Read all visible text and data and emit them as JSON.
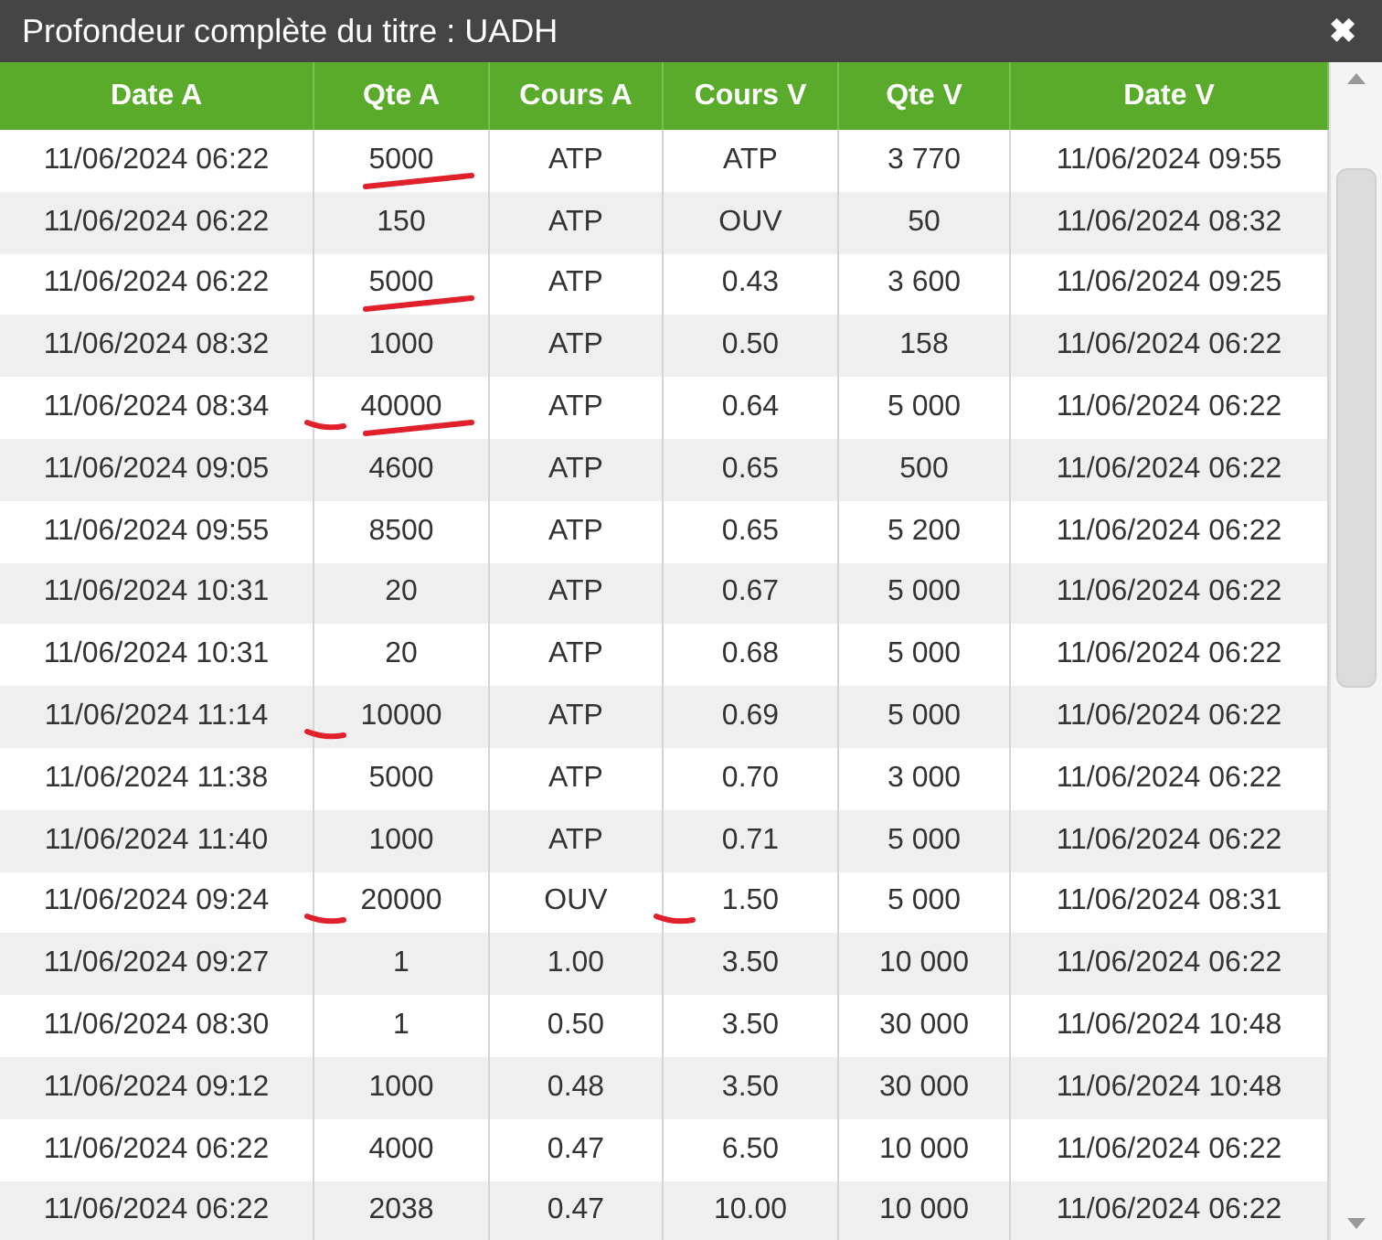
{
  "window": {
    "title": "Profondeur complète du titre : UADH",
    "close": "✖"
  },
  "table": {
    "columns": [
      "Date A",
      "Qte A",
      "Cours A",
      "Cours V",
      "Qte V",
      "Date V"
    ],
    "rows": [
      [
        {
          "text": "11/06/2024 06:22"
        },
        {
          "text": "5000",
          "pen_underline": true
        },
        {
          "text": "ATP"
        },
        {
          "text": "ATP"
        },
        {
          "text": "3 770"
        },
        {
          "text": "11/06/2024 09:55"
        }
      ],
      [
        {
          "text": "11/06/2024 06:22"
        },
        {
          "text": "150"
        },
        {
          "text": "ATP"
        },
        {
          "text": "OUV"
        },
        {
          "text": "50"
        },
        {
          "text": "11/06/2024 08:32"
        }
      ],
      [
        {
          "text": "11/06/2024 06:22"
        },
        {
          "text": "5000",
          "pen_underline": true
        },
        {
          "text": "ATP"
        },
        {
          "text": "0.43"
        },
        {
          "text": "3 600"
        },
        {
          "text": "11/06/2024 09:25"
        }
      ],
      [
        {
          "text": "11/06/2024 08:32"
        },
        {
          "text": "1000"
        },
        {
          "text": "ATP"
        },
        {
          "text": "0.50"
        },
        {
          "text": "158"
        },
        {
          "text": "11/06/2024 06:22"
        }
      ],
      [
        {
          "text": "11/06/2024 08:34"
        },
        {
          "text": "40000",
          "pen_dash": true,
          "pen_underline": true
        },
        {
          "text": "ATP"
        },
        {
          "text": "0.64"
        },
        {
          "text": "5 000"
        },
        {
          "text": "11/06/2024 06:22"
        }
      ],
      [
        {
          "text": "11/06/2024 09:05"
        },
        {
          "text": "4600"
        },
        {
          "text": "ATP"
        },
        {
          "text": "0.65"
        },
        {
          "text": "500"
        },
        {
          "text": "11/06/2024 06:22"
        }
      ],
      [
        {
          "text": "11/06/2024 09:55"
        },
        {
          "text": "8500"
        },
        {
          "text": "ATP"
        },
        {
          "text": "0.65"
        },
        {
          "text": "5 200"
        },
        {
          "text": "11/06/2024 06:22"
        }
      ],
      [
        {
          "text": "11/06/2024 10:31"
        },
        {
          "text": "20"
        },
        {
          "text": "ATP"
        },
        {
          "text": "0.67"
        },
        {
          "text": "5 000"
        },
        {
          "text": "11/06/2024 06:22"
        }
      ],
      [
        {
          "text": "11/06/2024 10:31"
        },
        {
          "text": "20"
        },
        {
          "text": "ATP"
        },
        {
          "text": "0.68"
        },
        {
          "text": "5 000"
        },
        {
          "text": "11/06/2024 06:22"
        }
      ],
      [
        {
          "text": "11/06/2024 11:14"
        },
        {
          "text": "10000",
          "pen_dash": true
        },
        {
          "text": "ATP"
        },
        {
          "text": "0.69"
        },
        {
          "text": "5 000"
        },
        {
          "text": "11/06/2024 06:22"
        }
      ],
      [
        {
          "text": "11/06/2024 11:38"
        },
        {
          "text": "5000"
        },
        {
          "text": "ATP"
        },
        {
          "text": "0.70"
        },
        {
          "text": "3 000"
        },
        {
          "text": "11/06/2024 06:22"
        }
      ],
      [
        {
          "text": "11/06/2024 11:40"
        },
        {
          "text": "1000"
        },
        {
          "text": "ATP"
        },
        {
          "text": "0.71"
        },
        {
          "text": "5 000"
        },
        {
          "text": "11/06/2024 06:22"
        }
      ],
      [
        {
          "text": "11/06/2024 09:24"
        },
        {
          "text": "20000",
          "pen_dash": true
        },
        {
          "text": "OUV"
        },
        {
          "text": "1.50",
          "pen_dash": true
        },
        {
          "text": "5 000"
        },
        {
          "text": "11/06/2024 08:31"
        }
      ],
      [
        {
          "text": "11/06/2024 09:27"
        },
        {
          "text": "1"
        },
        {
          "text": "1.00"
        },
        {
          "text": "3.50"
        },
        {
          "text": "10 000"
        },
        {
          "text": "11/06/2024 06:22"
        }
      ],
      [
        {
          "text": "11/06/2024 08:30"
        },
        {
          "text": "1"
        },
        {
          "text": "0.50"
        },
        {
          "text": "3.50"
        },
        {
          "text": "30 000"
        },
        {
          "text": "11/06/2024 10:48"
        }
      ],
      [
        {
          "text": "11/06/2024 09:12"
        },
        {
          "text": "1000"
        },
        {
          "text": "0.48"
        },
        {
          "text": "3.50"
        },
        {
          "text": "30 000"
        },
        {
          "text": "11/06/2024 10:48"
        }
      ],
      [
        {
          "text": "11/06/2024 06:22"
        },
        {
          "text": "4000"
        },
        {
          "text": "0.47"
        },
        {
          "text": "6.50"
        },
        {
          "text": "10 000"
        },
        {
          "text": "11/06/2024 06:22"
        }
      ],
      [
        {
          "text": "11/06/2024 06:22"
        },
        {
          "text": "2038"
        },
        {
          "text": "0.47"
        },
        {
          "text": "10.00"
        },
        {
          "text": "10 000"
        },
        {
          "text": "11/06/2024 06:22"
        }
      ]
    ]
  }
}
